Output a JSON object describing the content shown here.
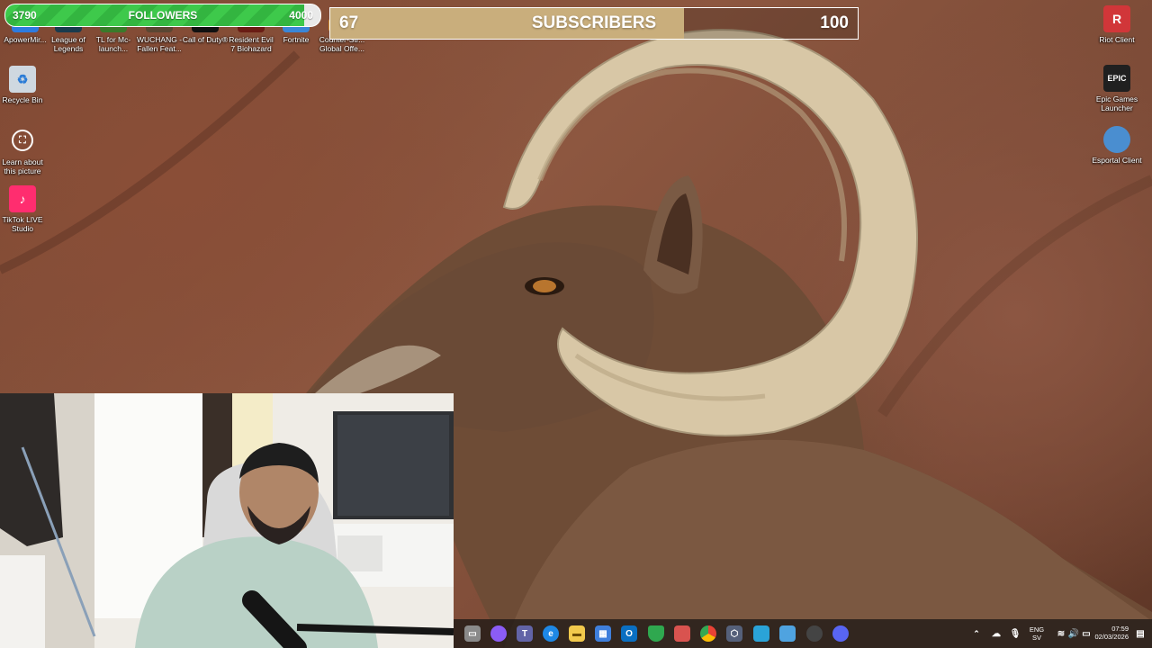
{
  "overlay": {
    "followers": {
      "current": "3790",
      "label": "FOLLOWERS",
      "goal": "4000",
      "progress": 0.9475,
      "fill_color": "#3ec94b"
    },
    "subscribers": {
      "current": "67",
      "label": "SUBSCRIBERS",
      "goal": "100",
      "progress": 0.67,
      "fill_color": "#c9ae7c"
    }
  },
  "desktop": {
    "top_icons": [
      {
        "label": "ApowerMir...",
        "icon": "apowermirror-icon",
        "color": "#2d7be0"
      },
      {
        "label": "League of Legends",
        "icon": "league-of-legends-icon",
        "color": "#1a3b4d"
      },
      {
        "label": "TL for Mc-launch...",
        "icon": "tlauncher-icon",
        "color": "#3a7a2a"
      },
      {
        "label": "WUCHANG - Fallen Feat...",
        "icon": "wuchang-icon",
        "color": "#5a4632"
      },
      {
        "label": "Call of Duty®",
        "icon": "call-of-duty-icon",
        "color": "#111111"
      },
      {
        "label": "Resident Evil 7 Biohazard",
        "icon": "resident-evil-icon",
        "color": "#6a1c14"
      },
      {
        "label": "Fortnite",
        "icon": "fortnite-icon",
        "color": "#3a86d8"
      },
      {
        "label": "Counter-Str... Global Offe...",
        "icon": "csgo-icon",
        "color": "#d08a2a"
      }
    ],
    "left_icons": [
      {
        "label": "Recycle Bin",
        "icon": "recycle-bin-icon",
        "color": "#cfd8e0"
      },
      {
        "label": "Learn about this picture",
        "icon": "learn-picture-icon",
        "color": "#333333"
      },
      {
        "label": "TikTok LIVE Studio",
        "icon": "tiktok-live-icon",
        "color": "#ff2d6f"
      }
    ],
    "right_icons": [
      {
        "label": "Riot Client",
        "icon": "riot-client-icon",
        "color": "#d13639",
        "glyph": "R"
      },
      {
        "label": "Epic Games Launcher",
        "icon": "epic-games-icon",
        "color": "#202020",
        "glyph": "EPIC"
      },
      {
        "label": "Esportal Client",
        "icon": "esportal-icon",
        "color": "#4a8ed0",
        "glyph": ""
      }
    ]
  },
  "taskbar": {
    "apps": [
      {
        "name": "file-manager-icon",
        "color": "#8a8a8a"
      },
      {
        "name": "copilot-icon",
        "color": "#8b5cf6"
      },
      {
        "name": "teams-icon",
        "color": "#6264a7"
      },
      {
        "name": "edge-icon",
        "color": "#1e88e5"
      },
      {
        "name": "explorer-icon",
        "color": "#f2c94c"
      },
      {
        "name": "store-icon",
        "color": "#3f7fdc"
      },
      {
        "name": "outlook-icon",
        "color": "#0a6fc2"
      },
      {
        "name": "vpn-shield-icon",
        "color": "#2fa84f"
      },
      {
        "name": "microsoft365-icon",
        "color": "#d9534f"
      },
      {
        "name": "chrome-icon",
        "color": "#e94235"
      },
      {
        "name": "app-hex-icon",
        "color": "#55607a"
      },
      {
        "name": "photos-icon",
        "color": "#2aa3d8"
      },
      {
        "name": "remote-desktop-icon",
        "color": "#4fa3e0"
      },
      {
        "name": "obs-icon",
        "color": "#444444"
      },
      {
        "name": "discord-icon",
        "color": "#5865f2"
      }
    ],
    "tray": {
      "language_top": "ENG",
      "language_bottom": "SV",
      "time": "07:59",
      "date": "02/03/2026"
    }
  }
}
